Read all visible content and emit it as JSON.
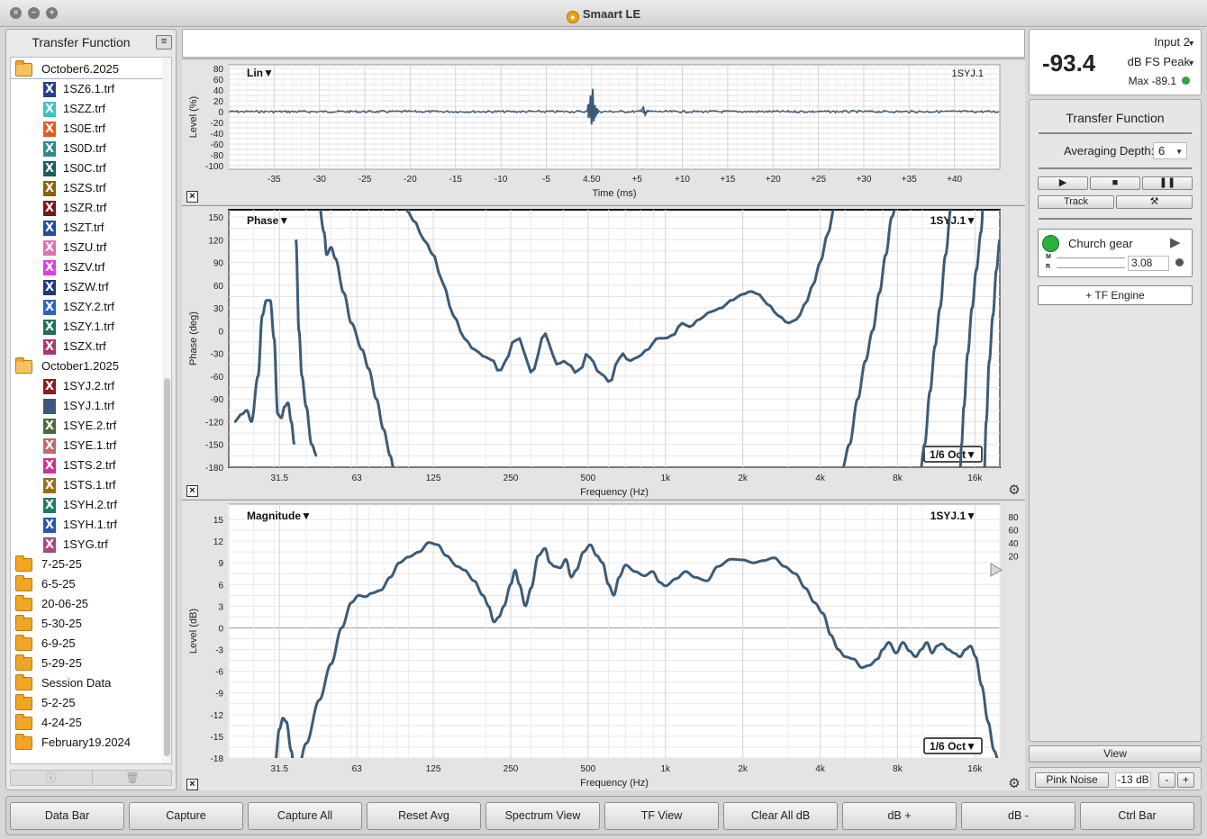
{
  "window": {
    "title": "Smaart LE"
  },
  "left_panel": {
    "title": "Transfer Function",
    "tree": [
      {
        "type": "folder-open",
        "label": "October6.2025",
        "indent": 0
      },
      {
        "type": "file",
        "label": "1SZ6.1.trf",
        "color": "#283c97"
      },
      {
        "type": "file",
        "label": "1SZZ.trf",
        "color": "#3dc3c2"
      },
      {
        "type": "file",
        "label": "1S0E.trf",
        "color": "#e85b1e"
      },
      {
        "type": "file",
        "label": "1S0D.trf",
        "color": "#2a8a8c"
      },
      {
        "type": "file",
        "label": "1S0C.trf",
        "color": "#1c5d5d"
      },
      {
        "type": "file",
        "label": "1SZS.trf",
        "color": "#8c6010"
      },
      {
        "type": "file",
        "label": "1SZR.trf",
        "color": "#7d1515"
      },
      {
        "type": "file",
        "label": "1SZT.trf",
        "color": "#1f4da0"
      },
      {
        "type": "file",
        "label": "1SZU.trf",
        "color": "#e070b6"
      },
      {
        "type": "file",
        "label": "1SZV.trf",
        "color": "#e13de0"
      },
      {
        "type": "file",
        "label": "1SZW.trf",
        "color": "#1e3a78"
      },
      {
        "type": "file",
        "label": "1SZY.2.trf",
        "color": "#2962c6"
      },
      {
        "type": "file",
        "label": "1SZY.1.trf",
        "color": "#1e7058"
      },
      {
        "type": "file",
        "label": "1SZX.trf",
        "color": "#a83576"
      },
      {
        "type": "folder-open",
        "label": "October1.2025",
        "indent": 0
      },
      {
        "type": "file",
        "label": "1SYJ.2.trf",
        "color": "#8b1c1c"
      },
      {
        "type": "file",
        "label": "1SYJ.1.trf",
        "color": "#3b5a7a",
        "blank": true
      },
      {
        "type": "file",
        "label": "1SYE.2.trf",
        "color": "#4a6b3a"
      },
      {
        "type": "file",
        "label": "1SYE.1.trf",
        "color": "#c06a6a"
      },
      {
        "type": "file",
        "label": "1STS.2.trf",
        "color": "#d0309a"
      },
      {
        "type": "file",
        "label": "1STS.1.trf",
        "color": "#9c6b16"
      },
      {
        "type": "file",
        "label": "1SYH.2.trf",
        "color": "#1e7a66"
      },
      {
        "type": "file",
        "label": "1SYH.1.trf",
        "color": "#2a56b0"
      },
      {
        "type": "file",
        "label": "1SYG.trf",
        "color": "#b0447e"
      },
      {
        "type": "folder",
        "label": "7-25-25"
      },
      {
        "type": "folder",
        "label": "6-5-25"
      },
      {
        "type": "folder",
        "label": "20-06-25"
      },
      {
        "type": "folder",
        "label": "5-30-25"
      },
      {
        "type": "folder",
        "label": "6-9-25"
      },
      {
        "type": "folder",
        "label": "5-29-25"
      },
      {
        "type": "folder",
        "label": "Session Data"
      },
      {
        "type": "folder",
        "label": "5-2-25"
      },
      {
        "type": "folder",
        "label": "4-24-25"
      },
      {
        "type": "folder",
        "label": "February19.2024"
      }
    ],
    "footer_info_icon": "ⓘ",
    "footer_trash_icon": "🗑"
  },
  "impulse_plot": {
    "mode_label": "Lin▼",
    "trace_label": "1SYJ.1",
    "ylabel": "Level (%)",
    "xlabel": "Time (ms)",
    "yticks": [
      "80",
      "60",
      "40",
      "20",
      "0",
      "-20",
      "-40",
      "-60",
      "-80",
      "-100"
    ],
    "xticks": [
      "-35",
      "-30",
      "-25",
      "-20",
      "-15",
      "-10",
      "-5",
      "4.50",
      "+5",
      "+10",
      "+15",
      "+20",
      "+25",
      "+30",
      "+35",
      "+40"
    ]
  },
  "phase_plot": {
    "mode_label": "Phase▼",
    "trace_label": "1SYJ.1▼",
    "smoothing_label": "1/6 Oct▼",
    "ylabel": "Phase (deg)",
    "xlabel": "Frequency (Hz)",
    "yticks": [
      "150",
      "120",
      "90",
      "60",
      "30",
      "0",
      "-30",
      "-60",
      "-90",
      "-120",
      "-150",
      "-180"
    ],
    "xticks": [
      "31.5",
      "63",
      "125",
      "250",
      "500",
      "1k",
      "2k",
      "4k",
      "8k",
      "16k"
    ]
  },
  "magnitude_plot": {
    "mode_label": "Magnitude▼",
    "trace_label": "1SYJ.1▼",
    "smoothing_label": "1/6 Oct▼",
    "ylabel": "Level (dB)",
    "xlabel": "Frequency (Hz)",
    "yticks": [
      "15",
      "12",
      "9",
      "6",
      "3",
      "0",
      "-3",
      "-6",
      "-9",
      "-12",
      "-15",
      "-18"
    ],
    "xticks": [
      "31.5",
      "63",
      "125",
      "250",
      "500",
      "1k",
      "2k",
      "4k",
      "8k",
      "16k"
    ],
    "coherence_ticks": [
      "80",
      "60",
      "40",
      "20"
    ]
  },
  "meter": {
    "value": "-93.4",
    "input": "Input 2",
    "mode": "dB FS Peak",
    "max": "Max -89.1"
  },
  "tf_panel": {
    "title": "Transfer Function",
    "averaging_label": "Averaging Depth:",
    "averaging_value": "6",
    "track_label": "Track",
    "measurement_name": "Church gear",
    "m_label": "M",
    "r_label": "R",
    "delay_value": "3.08",
    "engine_label": "+ TF Engine"
  },
  "view_label": "View",
  "generator": {
    "pink_label": "Pink Noise",
    "level": "-13 dB",
    "minus": "-",
    "plus": "+"
  },
  "control_bar": [
    "Data Bar",
    "Capture",
    "Capture All",
    "Reset Avg",
    "Spectrum View",
    "TF View",
    "Clear All dB",
    "dB +",
    "dB -",
    "Ctrl Bar"
  ],
  "colors": {
    "trace": "#3b5b78",
    "led_green": "#2bb23b"
  }
}
